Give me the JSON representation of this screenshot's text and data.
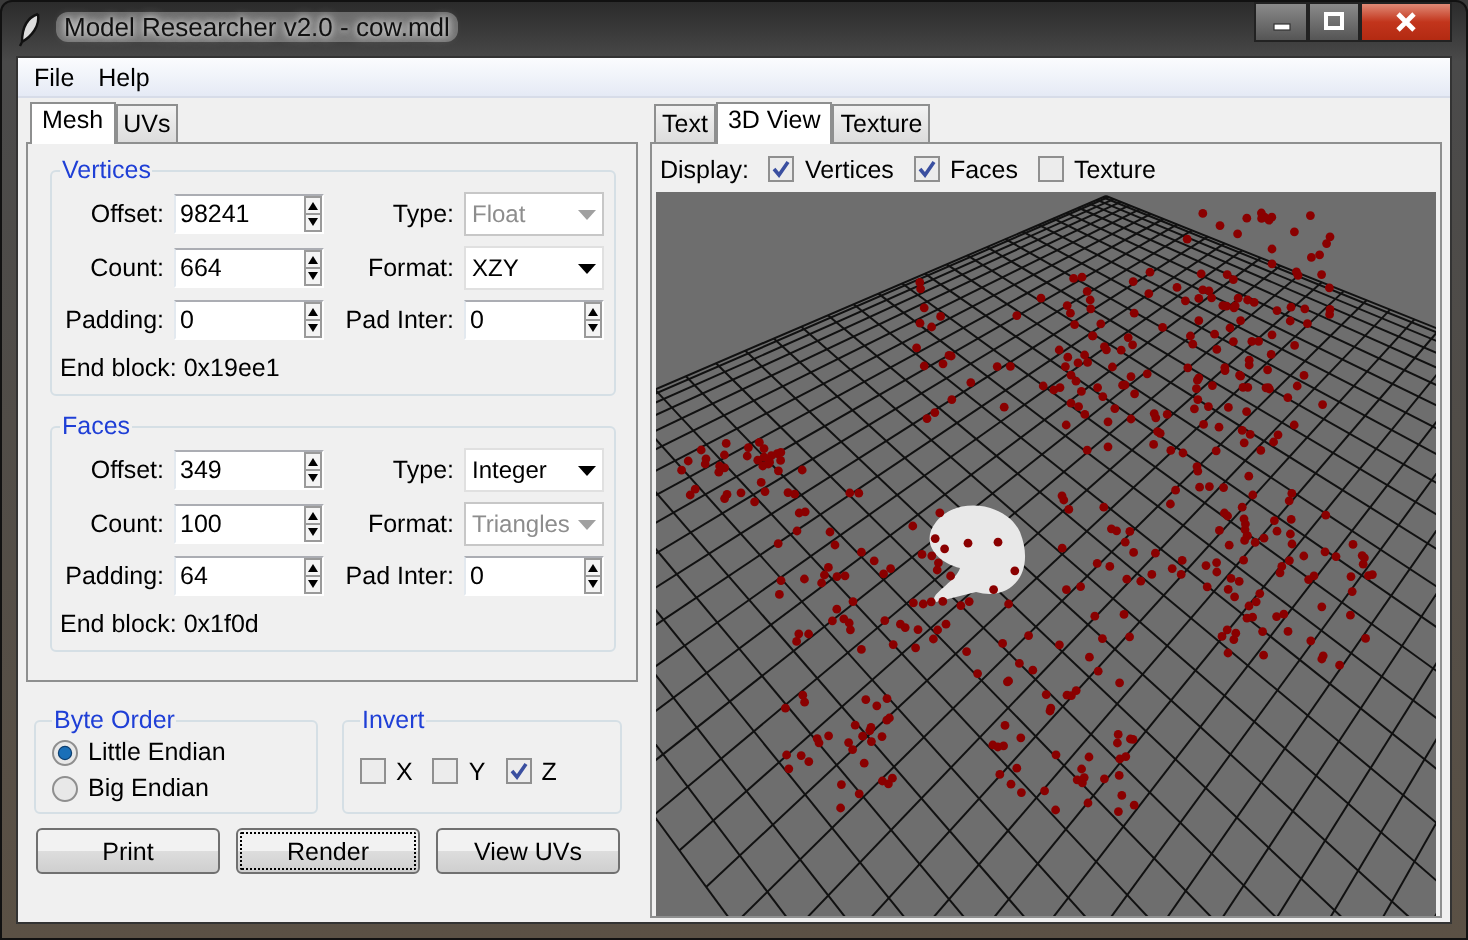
{
  "window": {
    "title": "Model Researcher v2.0 - cow.mdl"
  },
  "menu": [
    "File",
    "Help"
  ],
  "left_tabs": [
    {
      "label": "Mesh",
      "selected": true
    },
    {
      "label": "UVs",
      "selected": false
    }
  ],
  "groups": [
    {
      "title": "Vertices",
      "rows": [
        [
          {
            "label": "Offset:",
            "kind": "spin",
            "value": "98241",
            "disabled": false
          },
          {
            "label": "Type:",
            "kind": "combo",
            "value": "Float",
            "disabled": true
          }
        ],
        [
          {
            "label": "Count:",
            "kind": "spin",
            "value": "664",
            "disabled": false
          },
          {
            "label": "Format:",
            "kind": "combo",
            "value": "XZY",
            "disabled": false
          }
        ],
        [
          {
            "label": "Padding:",
            "kind": "spin",
            "value": "0",
            "disabled": false
          },
          {
            "label": "Pad Inter:",
            "kind": "spin",
            "value": "0",
            "disabled": false
          }
        ]
      ],
      "end_block": "End block: 0x19ee1"
    },
    {
      "title": "Faces",
      "rows": [
        [
          {
            "label": "Offset:",
            "kind": "spin",
            "value": "349",
            "disabled": false
          },
          {
            "label": "Type:",
            "kind": "combo",
            "value": "Integer",
            "disabled": false
          }
        ],
        [
          {
            "label": "Count:",
            "kind": "spin",
            "value": "100",
            "disabled": false
          },
          {
            "label": "Format:",
            "kind": "combo",
            "value": "Triangles",
            "disabled": true
          }
        ],
        [
          {
            "label": "Padding:",
            "kind": "spin",
            "value": "64",
            "disabled": false
          },
          {
            "label": "Pad Inter:",
            "kind": "spin",
            "value": "0",
            "disabled": false
          }
        ]
      ],
      "end_block": "End block: 0x1f0d"
    }
  ],
  "byte_order": {
    "title": "Byte Order",
    "options": [
      {
        "label": "Little Endian",
        "selected": true
      },
      {
        "label": "Big Endian",
        "selected": false
      }
    ]
  },
  "invert": {
    "title": "Invert",
    "options": [
      {
        "label": "X",
        "checked": false
      },
      {
        "label": "Y",
        "checked": false
      },
      {
        "label": "Z",
        "checked": true
      }
    ]
  },
  "buttons": [
    {
      "label": "Print",
      "focused": false
    },
    {
      "label": "Render",
      "focused": true
    },
    {
      "label": "View UVs",
      "focused": false
    }
  ],
  "right_tabs": [
    {
      "label": "Text",
      "selected": false
    },
    {
      "label": "3D View",
      "selected": true
    },
    {
      "label": "Texture",
      "selected": false
    }
  ],
  "display": {
    "label": "Display:",
    "options": [
      {
        "label": "Vertices",
        "checked": true
      },
      {
        "label": "Faces",
        "checked": true
      },
      {
        "label": "Texture",
        "checked": false
      }
    ]
  }
}
